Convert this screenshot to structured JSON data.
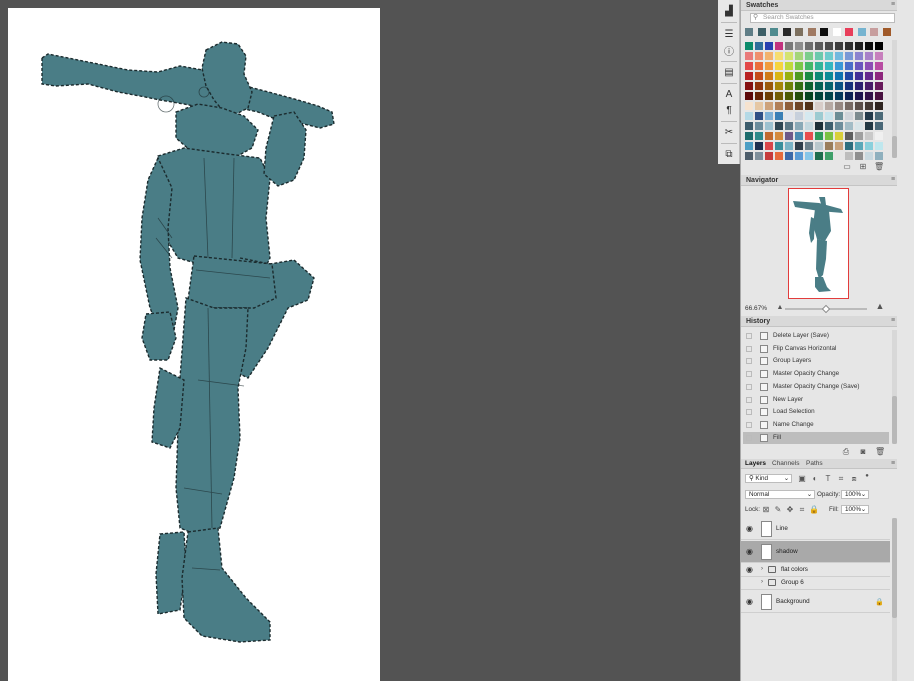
{
  "toolstrip": {
    "icons": [
      "histogram-icon",
      "adjustments-icon",
      "info-icon",
      "properties-icon",
      "character-icon",
      "paragraph-icon",
      "tools-icon",
      "libraries-icon"
    ]
  },
  "swatches": {
    "title": "Swatches",
    "search_placeholder": "Search Swatches",
    "recent": [
      "#5f7d86",
      "#3d5f66",
      "#4f8b8f",
      "#2a2a2a",
      "#7d705f",
      "#a07a63",
      "#0f0f0f",
      "#ffffff",
      "#e83e5a",
      "#76b4d0",
      "#c79e9e",
      "#a05a2a"
    ],
    "rows": [
      [
        "#0b8b6a",
        "#2f6e9b",
        "#2840b0",
        "#c2317e",
        "#7a7a7a",
        "#8d8d8d",
        "#6e6e6e",
        "#5b5b5b",
        "#4b4b4b",
        "#3c3c3c",
        "#2e2e2e",
        "#1e1e1e",
        "#0a0a0a",
        "#000000"
      ],
      [
        "#e97a7a",
        "#ef8e6d",
        "#f2b26d",
        "#f6dd6f",
        "#d4e36f",
        "#a5d57a",
        "#7ccd8c",
        "#6cc9ad",
        "#6dcbcd",
        "#72b9df",
        "#7898d6",
        "#8b83cf",
        "#a880c9",
        "#c77fbd"
      ],
      [
        "#e34a4a",
        "#ea6d3c",
        "#f09b3e",
        "#f5d43e",
        "#c0d93c",
        "#7bc74a",
        "#43b76a",
        "#33b49a",
        "#34b6c0",
        "#3a98d6",
        "#4a6ec8",
        "#6a57bd",
        "#8c4fb4",
        "#b84da3"
      ],
      [
        "#b82222",
        "#c44b19",
        "#cf7a16",
        "#d8b514",
        "#98b012",
        "#4e9a22",
        "#198a45",
        "#0c8876",
        "#0b8a97",
        "#1072b0",
        "#2246a2",
        "#422f96",
        "#65288d",
        "#8e277e"
      ],
      [
        "#851111",
        "#8f330c",
        "#9a590b",
        "#a4860a",
        "#6e8209",
        "#346f14",
        "#0d6230",
        "#046255",
        "#05636d",
        "#0a5283",
        "#16307a",
        "#2c1f6f",
        "#481b68",
        "#681a5c"
      ],
      [
        "#5c0909",
        "#642306",
        "#6c3e05",
        "#735e05",
        "#4c5b04",
        "#234d0b",
        "#064420",
        "#02443b",
        "#02444b",
        "#04385b",
        "#0c2154",
        "#1d144d",
        "#311248",
        "#481140"
      ],
      [
        "#f6e3cf",
        "#e5c7a4",
        "#cda27a",
        "#b17f57",
        "#8f5f3b",
        "#6f4628",
        "#523118",
        "#d7ccc8",
        "#b6a9a3",
        "#968882",
        "#776a64",
        "#5b4f4a",
        "#443934",
        "#2e2420"
      ],
      [
        "#b4d9e6",
        "#2f4f85",
        "#7fb1d6",
        "#3a7fb6",
        "#e1e5ed",
        "#c7d0dc",
        "#d5e9f0",
        "#9ccbd1",
        "#c7e4ec",
        "#6b8e96",
        "#d0d5da",
        "#7c8b8f",
        "#233a4a",
        "#4c6a78"
      ],
      [
        "#3c5c6c",
        "#6a8c9c",
        "#9cc1d0",
        "#2e4652",
        "#5b7785",
        "#8aa9b6",
        "#c3d7de",
        "#1e2f37",
        "#40606f",
        "#6e8e9c",
        "#a3bcc6",
        "#d8e4e8",
        "#223844",
        "#4a6878"
      ],
      [
        "#1c6b6b",
        "#2e8a8a",
        "#c26a2e",
        "#d48a3e",
        "#6e5a8a",
        "#4a8bb0",
        "#e84d4d",
        "#2f9a5a",
        "#7ac142",
        "#d9cf3a",
        "#5e5e5e",
        "#a0a0a0",
        "#c9c9c9",
        "#f0f0f0"
      ],
      [
        "#4c9ec4",
        "#1f2f4f",
        "#d9464a",
        "#3a8f9c",
        "#7ab3c6",
        "#2f3e4a",
        "#6a7f8a",
        "#b8c7cc",
        "#9a7d5a",
        "#c6a07a",
        "#2d6e7e",
        "#5aa8b8",
        "#8ad0dc",
        "#bfe7ee"
      ],
      [
        "#4d5d6a",
        "#7e8f9b",
        "#c63c3c",
        "#e66b3c",
        "#3d6aa8",
        "#5a9bd5",
        "#86c6e8",
        "#1e6e4e",
        "#3fa06a",
        "#e6e6e6",
        "#bdbdbd",
        "#8f8f8f",
        "#c9d9e0",
        "#8fb0be"
      ]
    ]
  },
  "navigator": {
    "title": "Navigator",
    "zoom": "66.67%"
  },
  "history": {
    "title": "History",
    "items": [
      {
        "label": "Delete Layer (Save)",
        "active": false
      },
      {
        "label": "Flip Canvas Horizontal",
        "active": false
      },
      {
        "label": "Group Layers",
        "active": false
      },
      {
        "label": "Master Opacity Change",
        "active": false
      },
      {
        "label": "Master Opacity Change (Save)",
        "active": false
      },
      {
        "label": "New Layer",
        "active": false
      },
      {
        "label": "Load Selection",
        "active": false
      },
      {
        "label": "Name Change",
        "active": false
      },
      {
        "label": "Fill",
        "active": true
      }
    ]
  },
  "layers": {
    "tabs": [
      "Layers",
      "Channels",
      "Paths"
    ],
    "filter_kind": "Kind",
    "blend_mode": "Normal",
    "opacity_label": "Opacity:",
    "opacity_value": "100%",
    "lock_label": "Lock:",
    "fill_label": "Fill:",
    "fill_value": "100%",
    "items": [
      {
        "name": "Line",
        "visible": true,
        "active": false,
        "type": "layer"
      },
      {
        "name": "shadow",
        "visible": true,
        "active": true,
        "type": "layer"
      },
      {
        "name": "flat colors",
        "visible": true,
        "active": false,
        "type": "group"
      },
      {
        "name": "Group 6",
        "visible": false,
        "active": false,
        "type": "group"
      },
      {
        "name": "Background",
        "visible": true,
        "active": false,
        "type": "background"
      }
    ]
  },
  "colors": {
    "workspace": "#535353",
    "figure_fill": "#4a7d86",
    "selected_row": "#a9a9a9",
    "navigator_border": "#e23c3c"
  }
}
